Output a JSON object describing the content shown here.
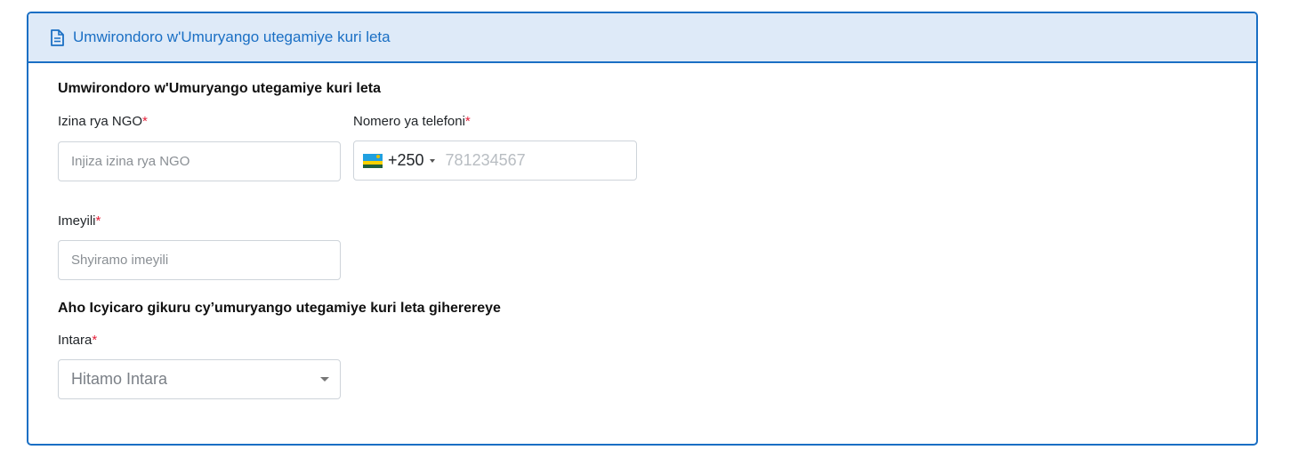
{
  "header": {
    "title": "Umwirondoro w'Umuryango utegamiye kuri leta",
    "icon": "document-icon"
  },
  "sections": {
    "profile_title": "Umwirondoro w'Umuryango utegamiye kuri leta",
    "location_title": "Aho Icyicaro gikuru cy’umuryango utegamiye kuri leta giherereye"
  },
  "fields": {
    "ngo_name": {
      "label": "Izina rya NGO",
      "required": "*",
      "placeholder": "Injiza izina rya NGO"
    },
    "phone": {
      "label": "Nomero ya telefoni",
      "required": "*",
      "country_code": "+250",
      "placeholder": "781234567",
      "flag_icon": "rwanda-flag-icon"
    },
    "email": {
      "label": "Imeyili",
      "required": "*",
      "placeholder": "Shyiramo imeyili"
    },
    "province": {
      "label": "Intara",
      "required": "*",
      "placeholder": "Hitamo Intara"
    }
  },
  "colors": {
    "accent": "#1a6fc4",
    "header_bg": "#deeaf8",
    "required": "#e5213b"
  }
}
